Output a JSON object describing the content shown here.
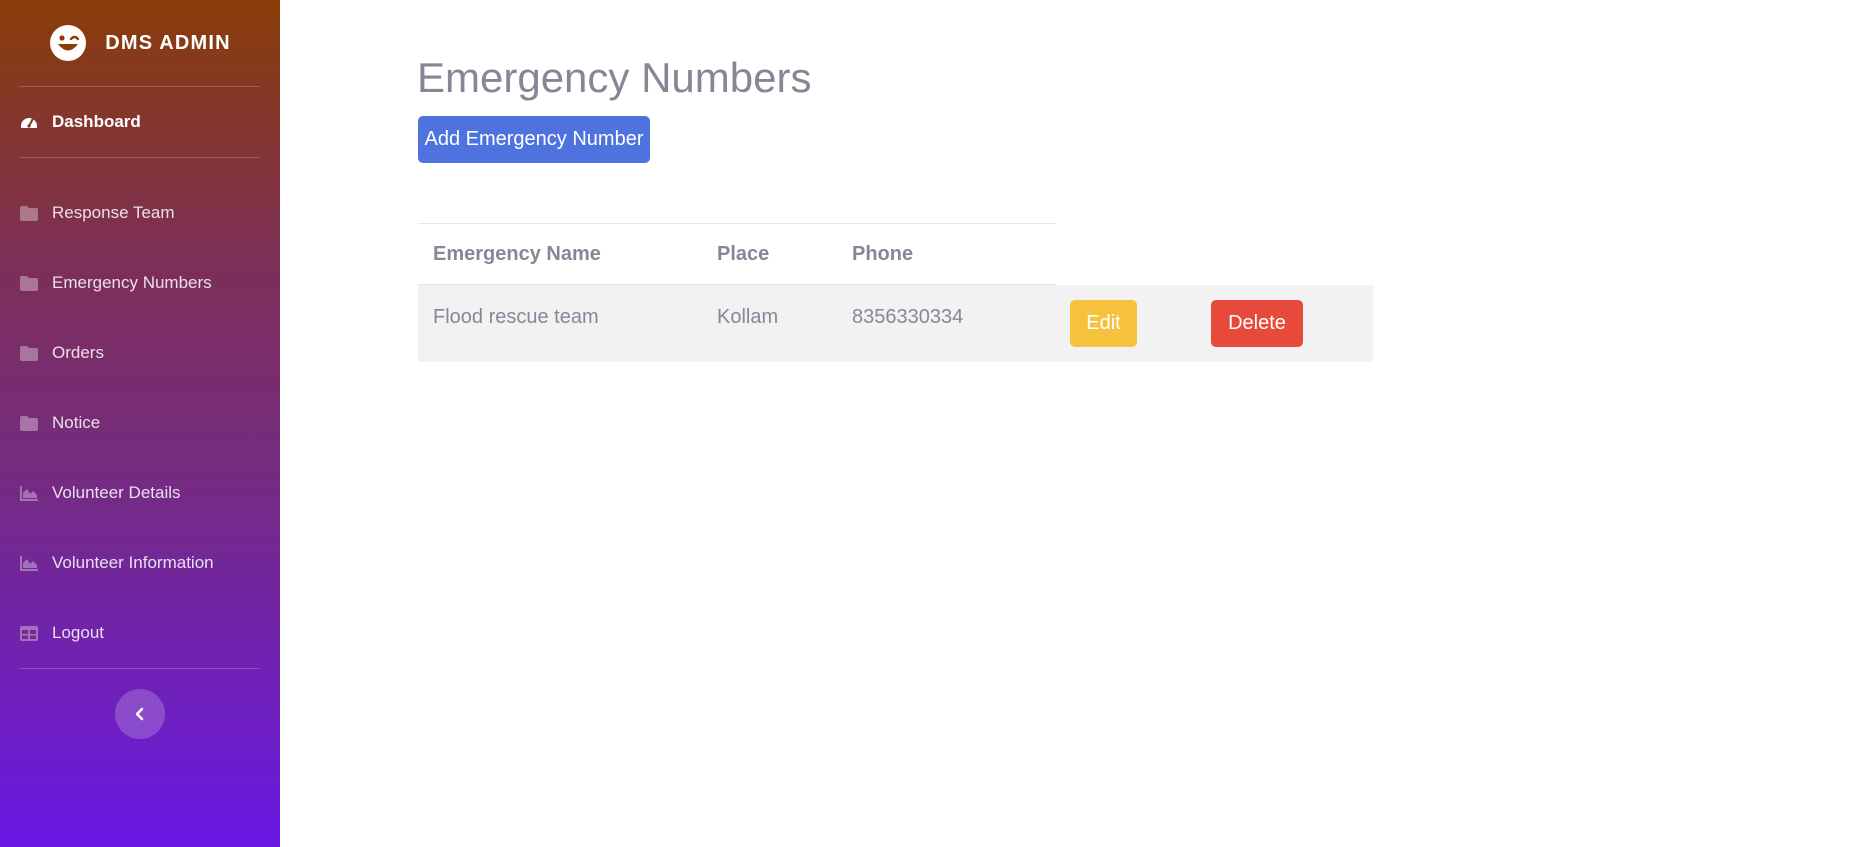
{
  "brand": {
    "title": "DMS ADMIN",
    "icon": "laugh-wink-icon"
  },
  "sidebar": {
    "items": [
      {
        "label": "Dashboard",
        "icon": "tachometer-icon",
        "active": true
      },
      {
        "label": "Response Team",
        "icon": "folder-icon"
      },
      {
        "label": "Emergency Numbers",
        "icon": "folder-icon"
      },
      {
        "label": "Orders",
        "icon": "folder-icon"
      },
      {
        "label": "Notice",
        "icon": "folder-icon"
      },
      {
        "label": "Volunteer Details",
        "icon": "area-chart-icon"
      },
      {
        "label": "Volunteer Information",
        "icon": "area-chart-icon"
      },
      {
        "label": "Logout",
        "icon": "table-icon"
      }
    ],
    "toggle_icon": "chevron-left-icon"
  },
  "main": {
    "title": "Emergency Numbers",
    "add_button": "Add Emergency Number",
    "table": {
      "headers": [
        "Emergency Name",
        "Place",
        "Phone"
      ],
      "rows": [
        {
          "name": "Flood rescue team",
          "place": "Kollam",
          "phone": "8356330334",
          "edit_label": "Edit",
          "delete_label": "Delete"
        }
      ]
    }
  },
  "colors": {
    "sidebar_top": "#8a3d08",
    "sidebar_bottom": "#6a18e3",
    "primary": "#4e73df",
    "warning": "#f6c23e",
    "danger": "#e74a3b",
    "text_muted": "#858796"
  }
}
